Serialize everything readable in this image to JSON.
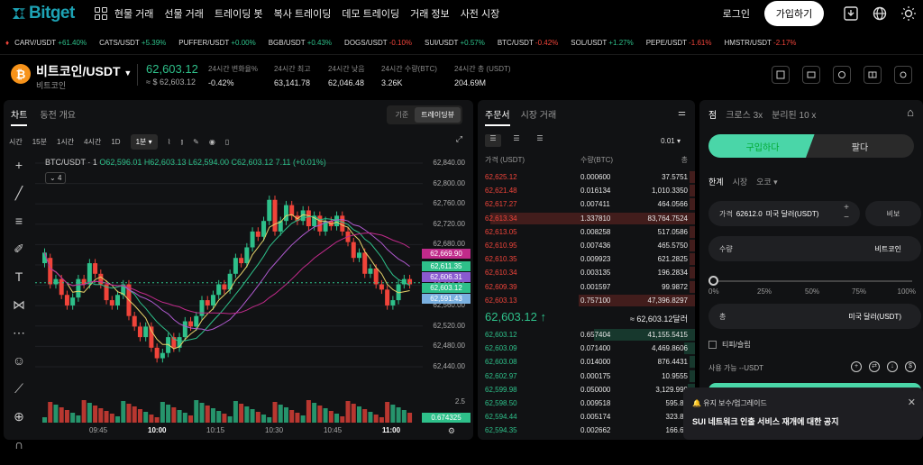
{
  "topbar": {
    "brand": "Bitget",
    "nav": [
      "현물 거래",
      "선물 거래",
      "트레이딩 봇",
      "복사 트레이딩",
      "데모 트레이딩",
      "거래 정보",
      "사전 시장"
    ],
    "login": "로그인",
    "signup": "가입하기"
  },
  "ticker": [
    {
      "sym": "CARV/USDT",
      "chg": "+61.40%",
      "up": true
    },
    {
      "sym": "CATS/USDT",
      "chg": "+5.39%",
      "up": true
    },
    {
      "sym": "PUFFER/USDT",
      "chg": "+0.00%",
      "up": true
    },
    {
      "sym": "BGB/USDT",
      "chg": "+0.43%",
      "up": true
    },
    {
      "sym": "DOGS/USDT",
      "chg": "-0.10%",
      "up": false
    },
    {
      "sym": "SUI/USDT",
      "chg": "+0.57%",
      "up": true
    },
    {
      "sym": "BTC/USDT",
      "chg": "-0.42%",
      "up": false
    },
    {
      "sym": "SOL/USDT",
      "chg": "+1.27%",
      "up": true
    },
    {
      "sym": "PEPE/USDT",
      "chg": "-1.61%",
      "up": false
    },
    {
      "sym": "HMSTR/USDT",
      "chg": "-2.17%",
      "up": false
    }
  ],
  "header": {
    "pair": "비트코인/USDT",
    "sub": "비트코인",
    "price": "62,603.12",
    "price_usd": "≈ $ 62,603.12",
    "stats": [
      {
        "label": "24시간 변화율%",
        "value": "-0.42%",
        "neg": true
      },
      {
        "label": "24시간 최고",
        "value": "63,141.78"
      },
      {
        "label": "24시간 낮음",
        "value": "62,046.48"
      },
      {
        "label": "24시간 수량(BTC)",
        "value": "3.26K"
      },
      {
        "label": "24시간 총 (USDT)",
        "value": "204.69M"
      }
    ]
  },
  "chart_tabs": {
    "chart": "차트",
    "overview": "동전 개요",
    "basic": "기준",
    "tv": "트레이딩뷰"
  },
  "timeframes": [
    "시간",
    "15분",
    "1시간",
    "4시간",
    "1D",
    "1분 ▾"
  ],
  "ohlc": {
    "pair": "BTC/USDT · 1",
    "o": "O62,596.01",
    "h": "H62,603.13",
    "l": "L62,594.00",
    "c": "C62,603.12",
    "chg": "7.11 (+0.01%)",
    "collapse": "4"
  },
  "chart_data": {
    "type": "candlestick",
    "price_axis": [
      "62,840.00",
      "62,800.00",
      "62,760.00",
      "62,720.00",
      "62,680.00",
      "62,640.00",
      "62,600.00",
      "62,560.00",
      "62,520.00",
      "62,480.00",
      "62,440.00"
    ],
    "tags": [
      {
        "v": "62,669.90",
        "c": "#c02a8a"
      },
      {
        "v": "62,611.35",
        "c": "#2ec08a"
      },
      {
        "v": "62,606.31",
        "c": "#8a5ad0"
      },
      {
        "v": "62,603.12",
        "c": "#2ec08a"
      },
      {
        "v": "62,591.43",
        "c": "#7ab0e0"
      }
    ],
    "vol_label": "2.5",
    "vol_tag": "0.674325",
    "x": [
      "09:45",
      "10:00",
      "10:15",
      "10:30",
      "10:45",
      "11:00"
    ],
    "ylim": [
      62420,
      62850
    ],
    "candles": [
      [
        62640,
        62660
      ],
      [
        62650,
        62600
      ],
      [
        62600,
        62610
      ],
      [
        62610,
        62580
      ],
      [
        62580,
        62560
      ],
      [
        62560,
        62575
      ],
      [
        62575,
        62610
      ],
      [
        62610,
        62600
      ],
      [
        62600,
        62640
      ],
      [
        62640,
        62620
      ],
      [
        62620,
        62600
      ],
      [
        62600,
        62570
      ],
      [
        62570,
        62560
      ],
      [
        62560,
        62580
      ],
      [
        62580,
        62600
      ],
      [
        62600,
        62540
      ],
      [
        62540,
        62520
      ],
      [
        62520,
        62500
      ],
      [
        62500,
        62520
      ],
      [
        62520,
        62480
      ],
      [
        62480,
        62460
      ],
      [
        62460,
        62470
      ],
      [
        62470,
        62500
      ],
      [
        62500,
        62480
      ],
      [
        62480,
        62500
      ],
      [
        62500,
        62530
      ],
      [
        62530,
        62520
      ],
      [
        62520,
        62540
      ],
      [
        62540,
        62570
      ],
      [
        62570,
        62560
      ],
      [
        62560,
        62580
      ],
      [
        62580,
        62600
      ],
      [
        62600,
        62590
      ],
      [
        62590,
        62620
      ],
      [
        62620,
        62650
      ],
      [
        62650,
        62640
      ],
      [
        62640,
        62670
      ],
      [
        62670,
        62700
      ],
      [
        62700,
        62690
      ],
      [
        62690,
        62720
      ],
      [
        62720,
        62760
      ],
      [
        62760,
        62700
      ],
      [
        62700,
        62720
      ],
      [
        62720,
        62750
      ],
      [
        62750,
        62730
      ],
      [
        62730,
        62720
      ],
      [
        62720,
        62740
      ],
      [
        62740,
        62710
      ],
      [
        62710,
        62730
      ],
      [
        62730,
        62700
      ],
      [
        62700,
        62720
      ],
      [
        62720,
        62710
      ],
      [
        62710,
        62730
      ],
      [
        62730,
        62700
      ],
      [
        62700,
        62680
      ],
      [
        62680,
        62650
      ],
      [
        62650,
        62660
      ],
      [
        62660,
        62620
      ],
      [
        62620,
        62630
      ],
      [
        62630,
        62600
      ],
      [
        62600,
        62590
      ],
      [
        62590,
        62560
      ],
      [
        62560,
        62570
      ],
      [
        62570,
        62600
      ],
      [
        62600,
        62610
      ],
      [
        62610,
        62600
      ]
    ]
  },
  "orderbook": {
    "tab1": "주문서",
    "tab2": "시장 거래",
    "precision": "0.01",
    "cols": [
      "가격 (USDT)",
      "수량(BTC)",
      "총"
    ],
    "asks": [
      [
        "62,625.12",
        "0.000600",
        "37.5751"
      ],
      [
        "62,621.48",
        "0.016134",
        "1,010.3350"
      ],
      [
        "62,617.27",
        "0.007411",
        "464.0566"
      ],
      [
        "62,613.34",
        "1.337810",
        "83,764.7524"
      ],
      [
        "62,613.05",
        "0.008258",
        "517.0586"
      ],
      [
        "62,610.95",
        "0.007436",
        "465.5750"
      ],
      [
        "62,610.35",
        "0.009923",
        "621.2825"
      ],
      [
        "62,610.34",
        "0.003135",
        "196.2834"
      ],
      [
        "62,609.39",
        "0.001597",
        "99.9872"
      ],
      [
        "62,603.13",
        "0.757100",
        "47,396.8297"
      ]
    ],
    "mid": "62,603.12 ↑",
    "mid_r": "≈ 62,603.12달러",
    "bids": [
      [
        "62,603.12",
        "0.657404",
        "41,155.5415"
      ],
      [
        "62,603.09",
        "0.071400",
        "4,469.8606"
      ],
      [
        "62,603.08",
        "0.014000",
        "876.4431"
      ],
      [
        "62,602.97",
        "0.000175",
        "10.9555"
      ],
      [
        "62,599.98",
        "0.050000",
        "3,129.999"
      ],
      [
        "62,598.50",
        "0.009518",
        "595.81"
      ],
      [
        "62,594.44",
        "0.005174",
        "323.86"
      ],
      [
        "62,594.35",
        "0.002662",
        "166.62"
      ]
    ]
  },
  "trade": {
    "modes": [
      "점",
      "크로스 3x",
      "분리된 10 x"
    ],
    "buy": "구입하다",
    "sell": "팔다",
    "types": [
      "한계",
      "시장",
      "오코 ▾"
    ],
    "price_label": "가격",
    "price_val": "62612.0",
    "price_unit": "미국 달러(USDT)",
    "bbo": "비보",
    "qty_label": "수량",
    "qty_unit": "비트코인",
    "total_label": "총",
    "total_unit": "미국 달러(USDT)",
    "slider": [
      "0%",
      "25%",
      "50%",
      "75%",
      "100%"
    ],
    "tpsl": "티피/슬립",
    "avail": "사용 가능  --USDT"
  },
  "notice": {
    "title": "유지 보수/업그레이드",
    "msg": "SUI 네트워크 인출 서비스 재개에 대한 공지"
  }
}
